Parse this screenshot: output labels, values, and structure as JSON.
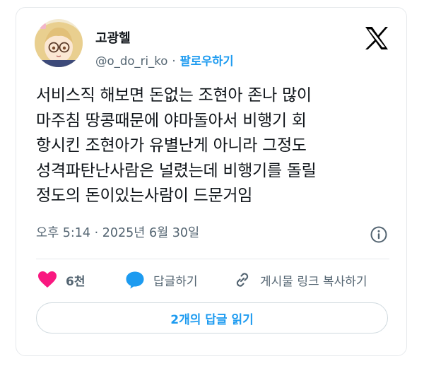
{
  "author": {
    "name": "고광헬",
    "handle": "@o_do_ri_ko",
    "separator": "·",
    "follow_label": "팔로우하기"
  },
  "tweet": {
    "lines": [
      "서비스직 해보면 돈없는 조현아 존나 많이",
      "마주침 땅콩때문에 야마돌아서 비행기 회",
      "항시킨 조현아가 유별난게 아니라 그정도",
      "성격파탄난사람은 널렸는데 비행기를 돌릴",
      "정도의 돈이있는사람이 드문거임"
    ],
    "timestamp": "오후 5:14 · 2025년 6월 30일"
  },
  "actions": {
    "like_count": "6천",
    "reply_label": "답글하기",
    "copy_link_label": "게시물 링크 복사하기"
  },
  "read_replies_label": "2개의 답글 읽기",
  "icons": {
    "brand": "x-logo-icon",
    "info": "info-icon",
    "like": "heart-icon",
    "reply": "speech-bubble-icon",
    "copy": "link-icon"
  },
  "colors": {
    "accent": "#1d9bf0",
    "like": "#f91880",
    "muted_text": "#536471",
    "text": "#0f1419",
    "border": "#cfd9de"
  }
}
